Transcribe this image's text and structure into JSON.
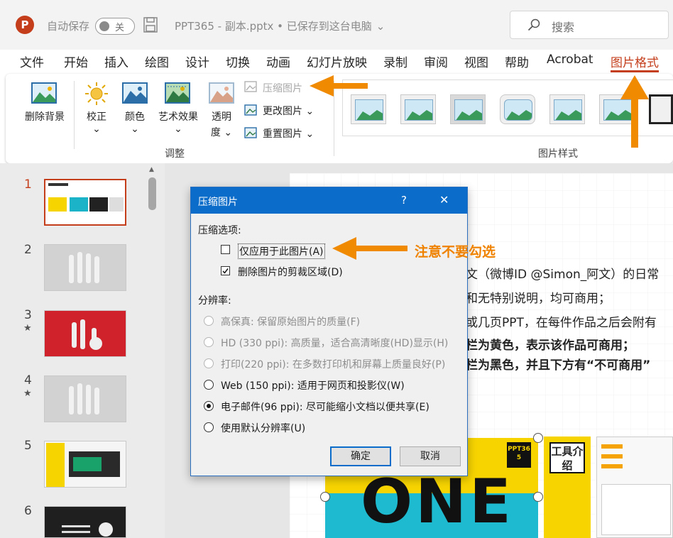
{
  "titlebar": {
    "app_icon": "P",
    "autosave_label": "自动保存",
    "autosave_state": "关",
    "doc_title": "PPT365 - 副本.pptx • 已保存到这台电脑",
    "search_placeholder": "搜索"
  },
  "ribbon_tabs": [
    "文件",
    "开始",
    "插入",
    "绘图",
    "设计",
    "切换",
    "动画",
    "幻灯片放映",
    "录制",
    "审阅",
    "视图",
    "帮助",
    "Acrobat",
    "图片格式"
  ],
  "ribbon": {
    "remove_bg": "删除背景",
    "correct": "校正",
    "color": "颜色",
    "art_effects": "艺术效果",
    "transparency_line1": "透明",
    "transparency_line2": "度",
    "compress": "压缩图片",
    "change_pic": "更改图片",
    "reset_pic": "重置图片",
    "group_adjust": "调整",
    "group_styles": "图片样式"
  },
  "slides": [
    {
      "num": "1",
      "star": ""
    },
    {
      "num": "2",
      "star": ""
    },
    {
      "num": "3",
      "star": "★"
    },
    {
      "num": "4",
      "star": "★"
    },
    {
      "num": "5",
      "star": ""
    },
    {
      "num": "6",
      "star": ""
    }
  ],
  "slide_content": {
    "line1": "文（微博ID @Simon_阿文）的日常",
    "line2": "和无特别说明，均可商用；",
    "line3": "或几页PPT，在每件作品之后会附有",
    "line4": "栏为黄色，表示该作品可商用；",
    "line5": "栏为黑色，并且下方有“不可商用”",
    "card_title": "工具介绍",
    "card_badge": "PPT365",
    "big_text": "ONE"
  },
  "dialog": {
    "title": "压缩图片",
    "help": "?",
    "close": "✕",
    "section_compress": "压缩选项:",
    "opt_apply_only": "仅应用于此图片(A)",
    "opt_delete_crop": "删除图片的剪裁区域(D)",
    "section_resolution": "分辨率:",
    "res_hifi": "高保真: 保留原始图片的质量(F)",
    "res_hd": "HD (330 ppi): 高质量，适合高清晰度(HD)显示(H)",
    "res_print": "打印(220 ppi): 在多数打印机和屏幕上质量良好(P)",
    "res_web": "Web (150 ppi): 适用于网页和投影仪(W)",
    "res_email": "电子邮件(96 ppi): 尽可能缩小文档以便共享(E)",
    "res_default": "使用默认分辨率(U)",
    "ok": "确定",
    "cancel": "取消",
    "apply_only_checked": false,
    "delete_crop_checked": true,
    "selected_resolution": "res_email"
  },
  "annotation": {
    "note": "注意不要勾选",
    "color": "#ef8200"
  }
}
